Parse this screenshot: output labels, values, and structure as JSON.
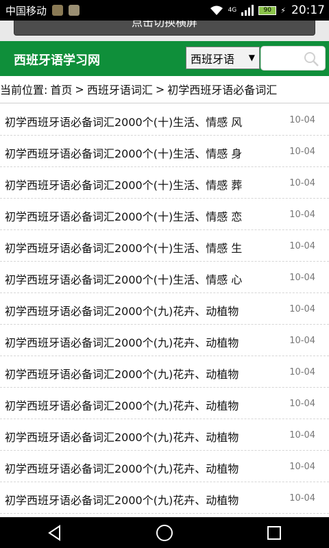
{
  "status_bar": {
    "carrier": "中国移动",
    "network": "4G",
    "battery": "90",
    "time": "20:17"
  },
  "landscape_button": {
    "label": "点击切换横屏"
  },
  "header": {
    "site_title": "西班牙语学习网",
    "language_select": "西班牙语",
    "search_placeholder": ""
  },
  "breadcrumb": {
    "prefix": "当前位置:",
    "items": [
      "首页",
      ">",
      "西班牙语词汇",
      ">",
      "初学西班牙语必备词汇"
    ]
  },
  "articles": [
    {
      "title": "初学西班牙语必备词汇2000个(十)生活、情感 风",
      "date": "10-04"
    },
    {
      "title": "初学西班牙语必备词汇2000个(十)生活、情感 身",
      "date": "10-04"
    },
    {
      "title": "初学西班牙语必备词汇2000个(十)生活、情感 葬",
      "date": "10-04"
    },
    {
      "title": "初学西班牙语必备词汇2000个(十)生活、情感 恋",
      "date": "10-04"
    },
    {
      "title": "初学西班牙语必备词汇2000个(十)生活、情感 生",
      "date": "10-04"
    },
    {
      "title": "初学西班牙语必备词汇2000个(十)生活、情感 心",
      "date": "10-04"
    },
    {
      "title": "初学西班牙语必备词汇2000个(九)花卉、动植物",
      "date": "10-04"
    },
    {
      "title": "初学西班牙语必备词汇2000个(九)花卉、动植物",
      "date": "10-04"
    },
    {
      "title": "初学西班牙语必备词汇2000个(九)花卉、动植物",
      "date": "10-04"
    },
    {
      "title": "初学西班牙语必备词汇2000个(九)花卉、动植物",
      "date": "10-04"
    },
    {
      "title": "初学西班牙语必备词汇2000个(九)花卉、动植物",
      "date": "10-04"
    },
    {
      "title": "初学西班牙语必备词汇2000个(九)花卉、动植物",
      "date": "10-04"
    },
    {
      "title": "初学西班牙语必备词汇2000个(九)花卉、动植物",
      "date": "10-04"
    }
  ],
  "colors": {
    "header_green": "#0f8f3a",
    "status_black": "#000000",
    "date_gray": "#777777"
  },
  "icons": {
    "search": "search-icon",
    "back": "back-icon",
    "home": "home-icon",
    "recents": "recents-icon"
  }
}
